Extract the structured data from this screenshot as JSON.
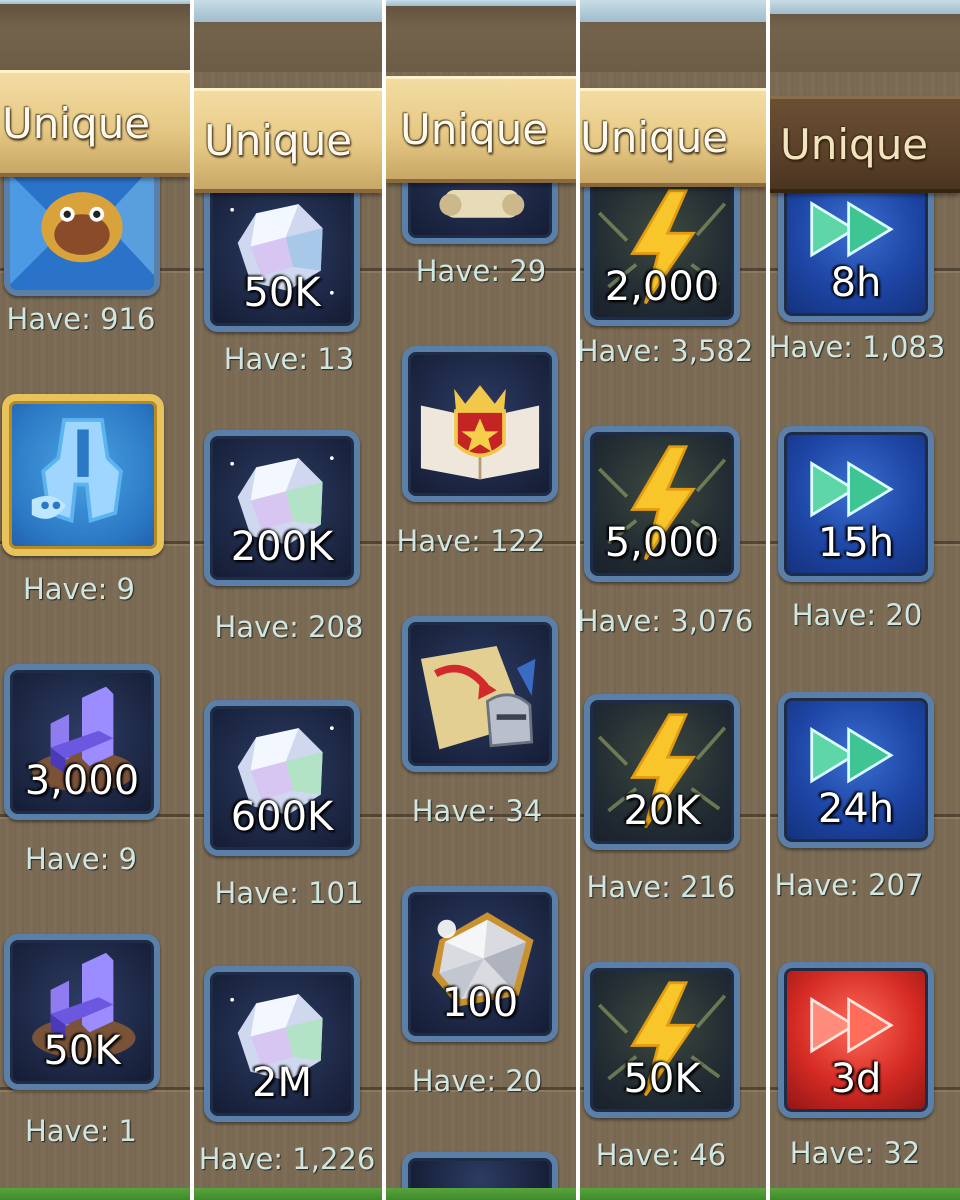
{
  "banner_label": "Unique",
  "colors": {
    "wood": "#7b6a54",
    "banner": "#e6c985",
    "banner_dark": "#5a412a",
    "card_border": "#5a7fa8",
    "have_text": "#cfe6e2"
  },
  "columns": [
    {
      "items": [
        {
          "icon": "hero-portrait-icon",
          "quantity": "",
          "have": "Have: 916"
        },
        {
          "icon": "spartan-helmet-mask-icon",
          "quantity": "",
          "have": "Have: 9"
        },
        {
          "icon": "purple-chair-icon",
          "quantity": "3,000",
          "have": "Have: 9"
        },
        {
          "icon": "purple-chair-icon",
          "quantity": "50K",
          "have": "Have: 1"
        }
      ]
    },
    {
      "items": [
        {
          "icon": "crystal-gem-icon",
          "quantity": "50K",
          "have": "Have: 13"
        },
        {
          "icon": "crystal-gem-icon",
          "quantity": "200K",
          "have": "Have: 208"
        },
        {
          "icon": "crystal-gem-icon",
          "quantity": "600K",
          "have": "Have: 101"
        },
        {
          "icon": "crystal-gem-icon",
          "quantity": "2M",
          "have": "Have: 1,226"
        }
      ]
    },
    {
      "items": [
        {
          "icon": "scroll-icon",
          "quantity": "",
          "have": "Have: 29"
        },
        {
          "icon": "crowned-book-icon",
          "quantity": "",
          "have": "Have: 122"
        },
        {
          "icon": "map-knight-helmet-icon",
          "quantity": "",
          "have": "Have: 34"
        },
        {
          "icon": "silver-star-stone-icon",
          "quantity": "100",
          "have": "Have: 20"
        }
      ]
    },
    {
      "items": [
        {
          "icon": "lightning-bolt-icon",
          "quantity": "2,000",
          "have": "Have: 3,582"
        },
        {
          "icon": "lightning-bolt-icon",
          "quantity": "5,000",
          "have": "Have: 3,076"
        },
        {
          "icon": "lightning-bolt-icon",
          "quantity": "20K",
          "have": "Have: 216"
        },
        {
          "icon": "lightning-bolt-icon",
          "quantity": "50K",
          "have": "Have: 46"
        }
      ]
    },
    {
      "items": [
        {
          "icon": "speedup-arrows-icon",
          "quantity": "8h",
          "have": "Have: 1,083"
        },
        {
          "icon": "speedup-arrows-icon",
          "quantity": "15h",
          "have": "Have: 20"
        },
        {
          "icon": "speedup-arrows-icon",
          "quantity": "24h",
          "have": "Have: 207"
        },
        {
          "icon": "red-speedup-arrows-icon",
          "quantity": "3d",
          "have": "Have: 32"
        }
      ]
    }
  ]
}
